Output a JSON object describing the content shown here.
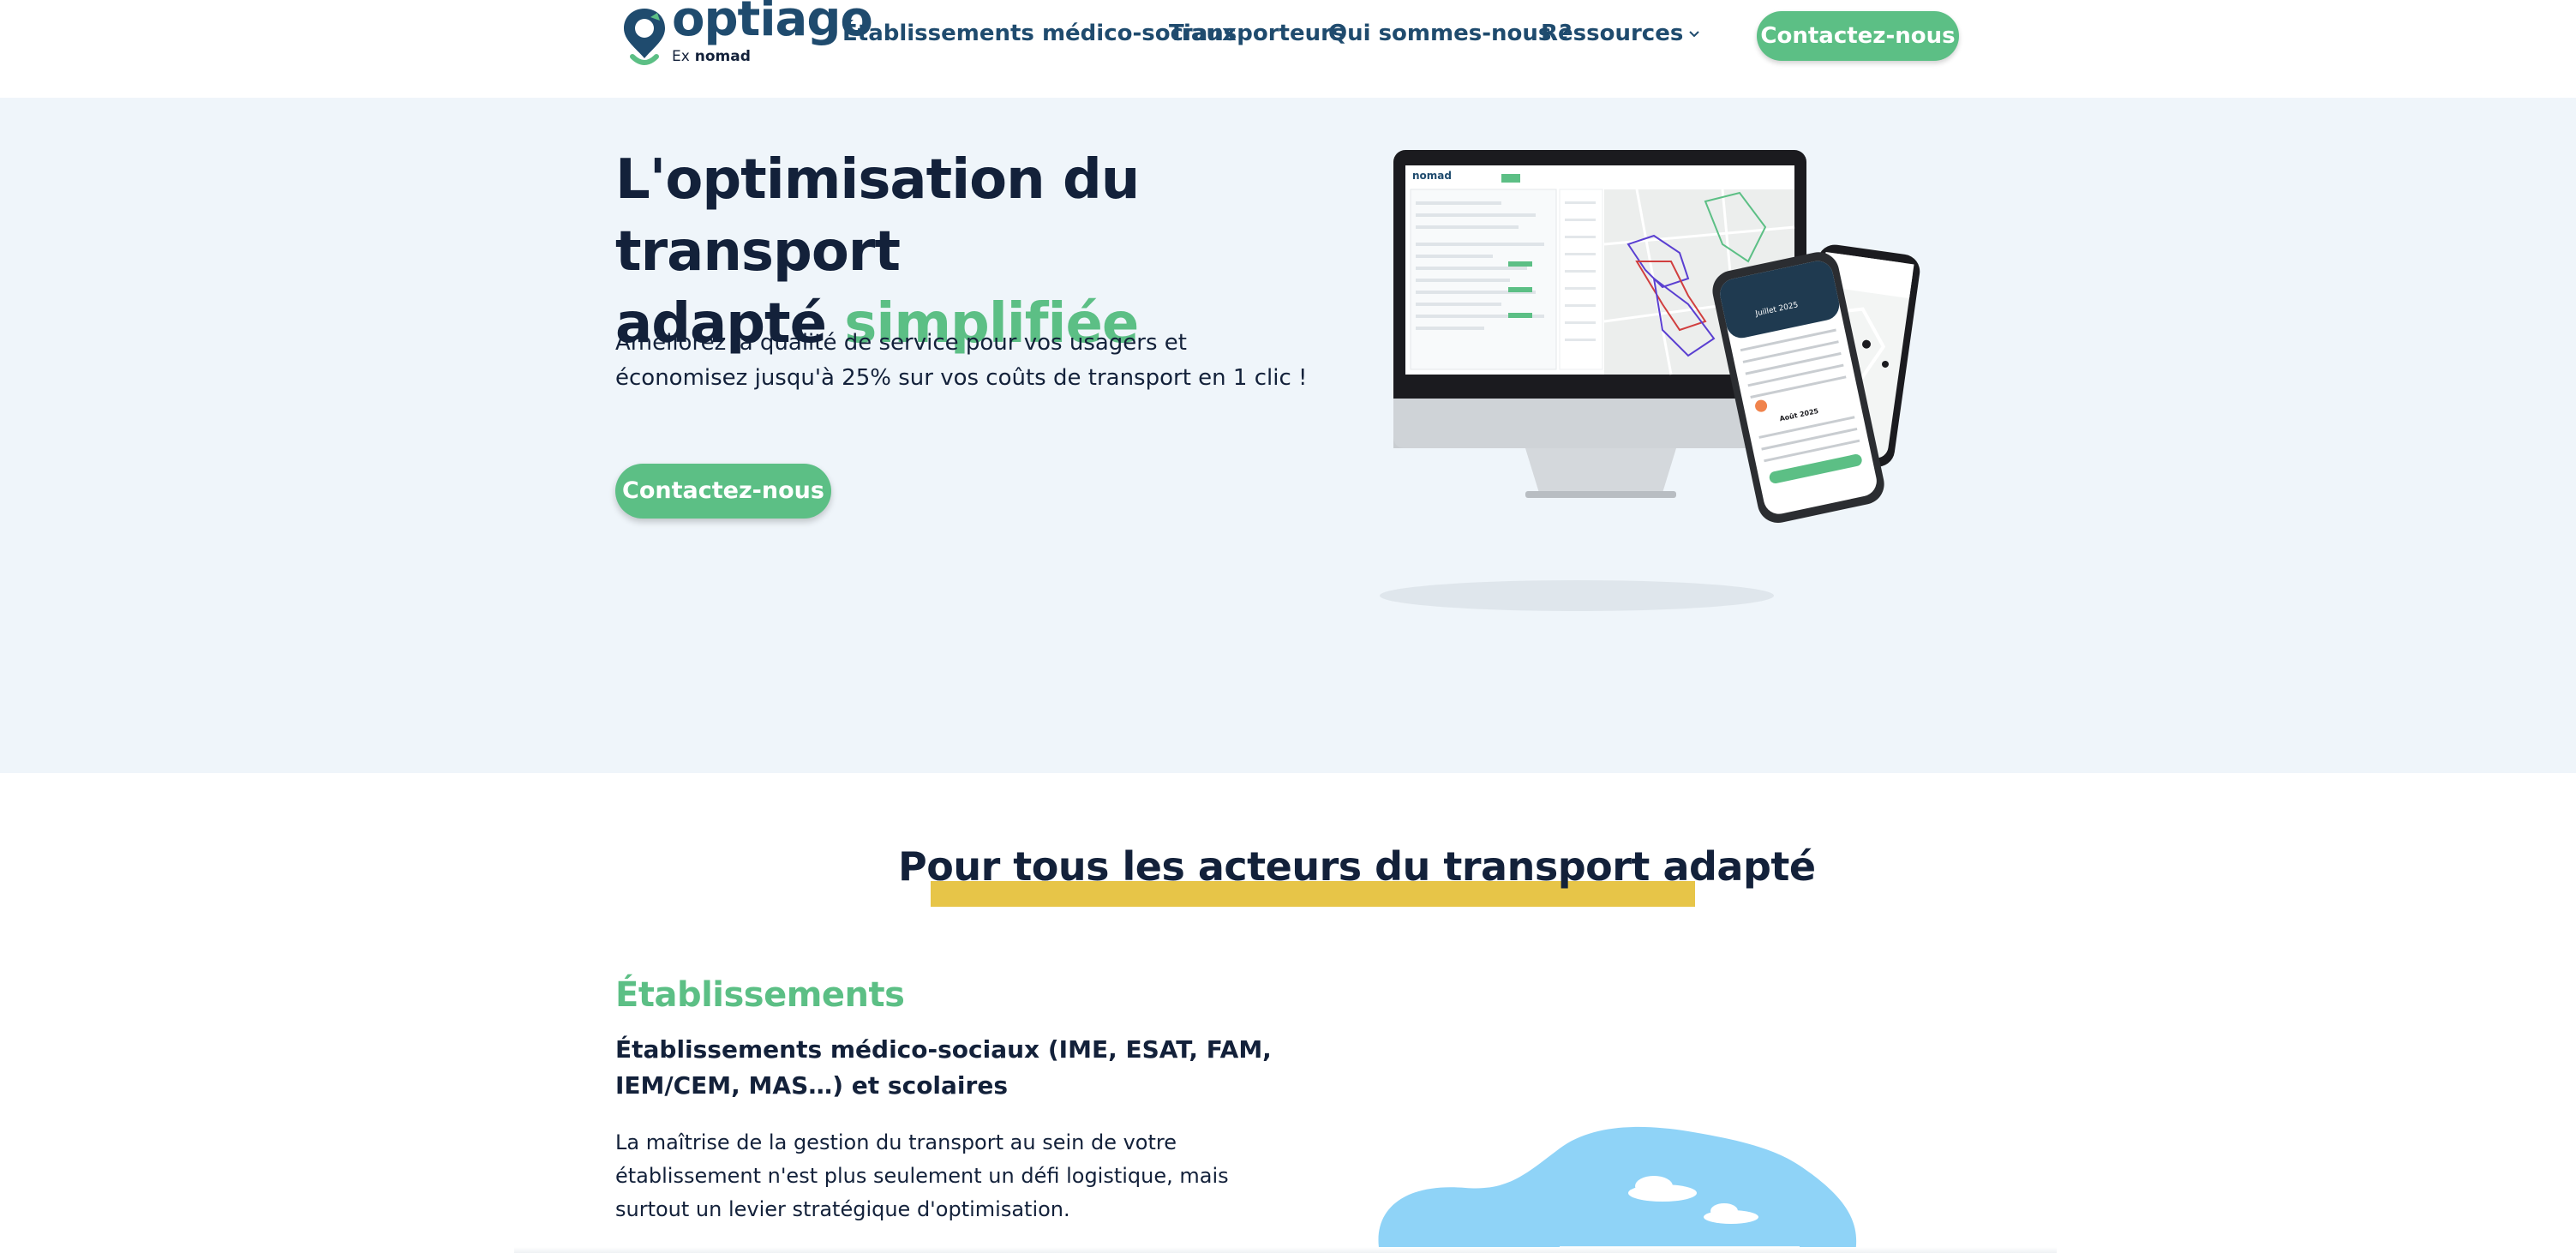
{
  "header": {
    "logo": {
      "wordmark": "optiago",
      "sub_prefix": "Ex",
      "sub_name": "nomad"
    },
    "nav": {
      "item1": "Établissements médico-sociaux",
      "item2": "Transporteurs",
      "item3": "Qui sommes-nous ?",
      "item4": "Ressources"
    },
    "cta_label": "Contactez-nous"
  },
  "hero": {
    "title_line1": "L'optimisation du transport",
    "title_line2_plain": "adapté",
    "title_line2_accent": "simplifiée",
    "description": "Améliorez la qualité de service pour vos usagers et économisez jusqu'à 25% sur vos coûts de transport en 1 clic !",
    "cta_label": "Contactez-nous",
    "image_text": {
      "app_logo": "nomad",
      "calendar_month1": "Juillet 2025",
      "calendar_month2": "Août 2025"
    }
  },
  "actors_section": {
    "title": "Pour tous les acteurs du transport adapté",
    "establishments": {
      "title": "Établissements",
      "subtitle": "Établissements médico-sociaux (IME, ESAT, FAM, IEM/CEM, MAS…) et scolaires",
      "text": "La maîtrise de la gestion du transport au sein de votre établissement n'est plus seulement un défi logistique, mais surtout un levier stratégique d'optimisation."
    }
  },
  "colors": {
    "brand_dark": "#1f4b6e",
    "accent_green": "#5cbf85",
    "highlight_yellow": "#e7c548",
    "hero_background": "#eff5fa",
    "text_dark": "#13213a"
  },
  "icons": [
    "logo-pin-icon",
    "chevron-down-icon"
  ]
}
